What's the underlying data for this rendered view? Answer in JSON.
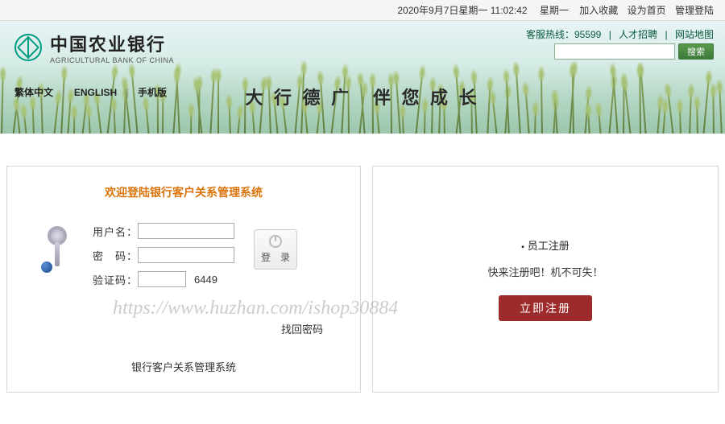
{
  "topbar": {
    "datetime": "2020年9月7日星期一  11:02:42",
    "weekday": "星期一",
    "favorite": "加入收藏",
    "homepage": "设为首页",
    "admin": "管理登陆"
  },
  "header": {
    "logo_cn": "中国农业银行",
    "logo_en": "AGRICULTURAL BANK OF CHINA",
    "hotline": "客服热线：95599",
    "recruit": "人才招聘",
    "sitemap": "网站地图",
    "search_btn": "搜索",
    "lang_traditional": "繁体中文",
    "lang_english": "ENGLISH",
    "lang_mobile": "手机版",
    "slogan": "大 行 德 广　伴 您 成 长"
  },
  "login": {
    "title": "欢迎登陆银行客户关系管理系统",
    "username_label": "用户名：",
    "password_label": "密　码：",
    "captcha_label": "验证码：",
    "captcha_code": "6449",
    "login_btn": "登　录",
    "forgot": "找回密码",
    "system_name": "银行客户关系管理系统"
  },
  "register": {
    "title": "员工注册",
    "subtitle": "快来注册吧！机不可失！",
    "btn": "立即注册"
  },
  "watermark": "https://www.huzhan.com/ishop30884"
}
